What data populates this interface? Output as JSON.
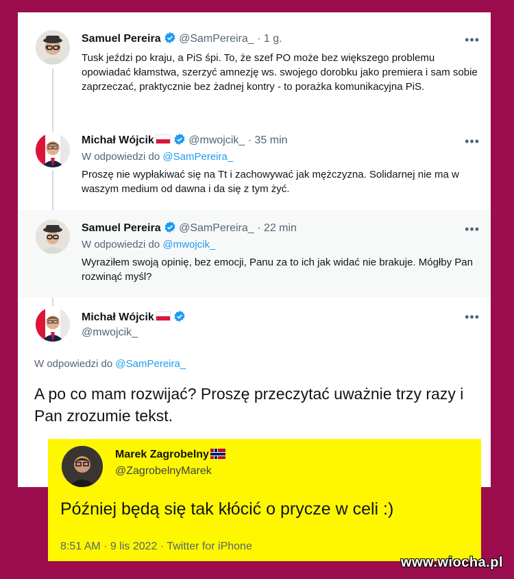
{
  "tweets": [
    {
      "name": "Samuel Pereira",
      "handle": "@SamPereira_",
      "time": "· 1 g.",
      "text": "Tusk jeździ po kraju, a PiS śpi. To, że szef PO może bez większego problemu opowiadać kłamstwa, szerzyć amnezję ws. swojego dorobku jako premiera i sam sobie zaprzeczać, praktycznie bez żadnej kontry - to porażka komunikacyjna PiS."
    },
    {
      "name": "Michał Wójcik",
      "handle": "@mwojcik_",
      "time": "· 35 min",
      "reply_prefix": "W odpowiedzi do",
      "reply_to": "@SamPereira_",
      "text": "Proszę nie wypłakiwać się na Tt i zachowywać jak mężczyzna. Solidarnej nie ma w waszym medium od dawna i da się z tym żyć."
    },
    {
      "name": "Samuel Pereira",
      "handle": "@SamPereira_",
      "time": "· 22 min",
      "reply_prefix": "W odpowiedzi do",
      "reply_to": "@mwojcik_",
      "text": "Wyraziłem swoją opinię, bez emocji, Panu za to ich jak widać nie brakuje. Mógłby Pan rozwinąć myśl?"
    },
    {
      "name": "Michał Wójcik",
      "handle": "@mwojcik_",
      "reply_prefix": "W odpowiedzi do",
      "reply_to": "@SamPereira_",
      "text": "A po co mam rozwijać? Proszę przeczytać uważnie trzy razy i Pan zrozumie tekst."
    }
  ],
  "more_label": "•••",
  "quote": {
    "name": "Marek Zagrobelny",
    "handle": "@ZagrobelnyMarek",
    "text": "Później będą się tak kłócić o prycze w celi :)",
    "meta": "8:51 AM · 9 lis 2022 · Twitter for iPhone"
  },
  "watermark": "www.wiocha.pl",
  "colors": {
    "background": "#9b0d4c",
    "highlight": "#fff700",
    "link": "#1d9bf0",
    "verified": "#1d9bf0"
  }
}
